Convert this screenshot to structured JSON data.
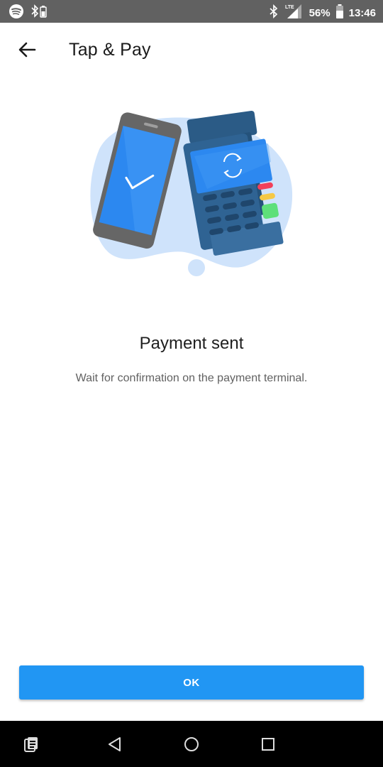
{
  "status_bar": {
    "battery": "56%",
    "time": "13:46",
    "network": "LTE",
    "icons": [
      "spotify-icon",
      "bluetooth-battery-icon",
      "bluetooth-icon",
      "signal-icon",
      "battery-icon"
    ]
  },
  "header": {
    "title": "Tap & Pay",
    "back_icon": "arrow-left-icon"
  },
  "main": {
    "headline": "Payment sent",
    "message": "Wait for confirmation on the payment terminal."
  },
  "actions": {
    "ok_label": "OK"
  },
  "nav_bar": {
    "icons": [
      "recents-app-icon",
      "back-triangle-icon",
      "home-circle-icon",
      "overview-square-icon"
    ]
  },
  "colors": {
    "accent": "#2196f3",
    "status_bar_bg": "#616161",
    "blob": "#cfe3fb",
    "phone_screen": "#2c88f0",
    "terminal_body": "#2d5f8f"
  }
}
